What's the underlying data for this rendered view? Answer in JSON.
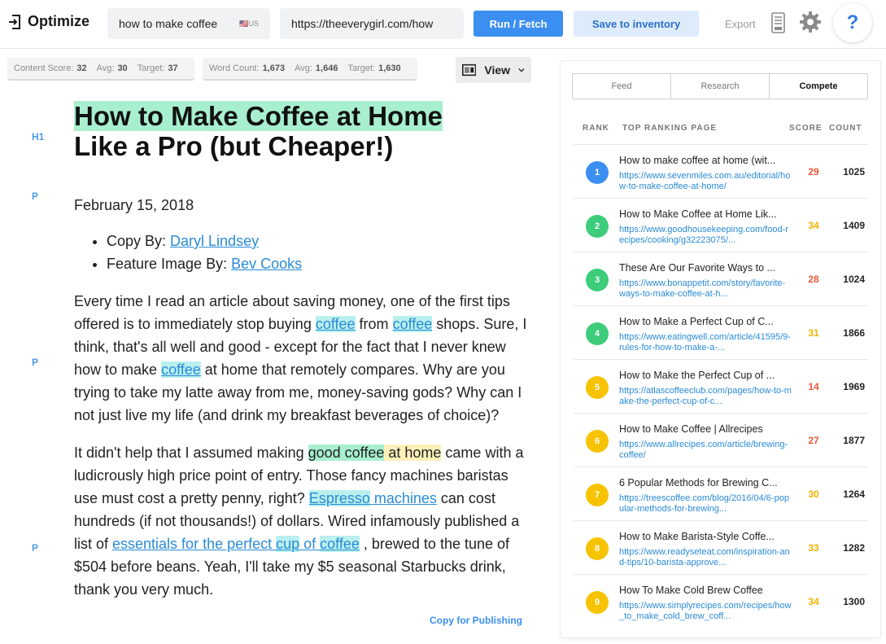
{
  "app": {
    "title": "Optimize"
  },
  "search": {
    "keyword": "how to make coffee",
    "locale": "US",
    "url": "https://theeverygirl.com/how"
  },
  "toolbar": {
    "run_label": "Run / Fetch",
    "save_label": "Save to inventory",
    "export_label": "Export",
    "help_label": "?"
  },
  "metrics": {
    "content_score": {
      "label": "Content Score:",
      "value": "32",
      "avg_label": "Avg:",
      "avg": "30",
      "target_label": "Target:",
      "target": "37"
    },
    "word_count": {
      "label": "Word Count:",
      "value": "1,673",
      "avg_label": "Avg:",
      "avg": "1,646",
      "target_label": "Target:",
      "target": "1,630"
    }
  },
  "view": {
    "label": "View"
  },
  "editor": {
    "tags": {
      "h1": "H1",
      "p": "P"
    },
    "h1_hl": "How to Make Coffee at Home",
    "h1_rest": "Like a Pro (but Cheaper!)",
    "date": "February 15, 2018",
    "credits": [
      {
        "label": "Copy By: ",
        "link": "Daryl Lindsey"
      },
      {
        "label": "Feature Image By: ",
        "link": "Bev Cooks"
      }
    ],
    "para1": {
      "t1": "Every time I read an article about saving money, one of the first tips offered is to immediately stop buying ",
      "k1": "coffee",
      "t2": " from ",
      "k2": "coffee",
      "t3": " shops. Sure, I think, that's all well and good - except for the fact that I never knew how to make ",
      "k3": "coffee",
      "t4": " at home that remotely compares. Why are you trying to take my latte away from me, money-saving gods? Why can I not just live my life (and drink my breakfast beverages of choice)?"
    },
    "para2": {
      "t1": "It didn't help that I assumed making ",
      "k1": "good coffee",
      "k2": " at home",
      "t2": " came with a ludicrously high price point of entry. Those fancy machines baristas use must cost a pretty penny, right? ",
      "k3": "Espresso",
      "l1": " machines",
      "t3": " can cost hundreds (if not thousands!) of dollars. Wired infamously published a list of ",
      "l2": "essentials for the perfect ",
      "k4": "cup",
      "l3": " of ",
      "k5": "coffee",
      "t4": " , brewed to the tune of $504 before beans. Yeah, I'll take my $5 seasonal Starbucks drink, thank you very much."
    },
    "copy_label": "Copy for Publishing"
  },
  "panel": {
    "tabs": [
      {
        "label": "Feed"
      },
      {
        "label": "Research"
      },
      {
        "label": "Compete"
      }
    ],
    "headers": {
      "rank": "RANK",
      "page": "TOP RANKING PAGE",
      "score": "SCORE",
      "count": "COUNT"
    },
    "results": [
      {
        "rank": "1",
        "title": "How to make coffee at home (wit...",
        "url": "https://www.sevenmiles.com.au/editorial/how-to-make-coffee-at-home/",
        "score": "29",
        "count": "1025",
        "rank_color": "#3b8ff0",
        "score_color": "#e8593b"
      },
      {
        "rank": "2",
        "title": "How to Make Coffee at Home Lik...",
        "url": "https://www.goodhousekeeping.com/food-recipes/cooking/g32223075/...",
        "score": "34",
        "count": "1409",
        "rank_color": "#3dcc7a",
        "score_color": "#f2b400"
      },
      {
        "rank": "3",
        "title": "These Are Our Favorite Ways to ...",
        "url": "https://www.bonappetit.com/story/favorite-ways-to-make-coffee-at-h...",
        "score": "28",
        "count": "1024",
        "rank_color": "#3dcc7a",
        "score_color": "#e8593b"
      },
      {
        "rank": "4",
        "title": "How to Make a Perfect Cup of C...",
        "url": "https://www.eatingwell.com/article/41595/9-rules-for-how-to-make-a-...",
        "score": "31",
        "count": "1866",
        "rank_color": "#3dcc7a",
        "score_color": "#f2b400"
      },
      {
        "rank": "5",
        "title": "How to Make the Perfect Cup of ...",
        "url": "https://atlascoffeeclub.com/pages/how-to-make-the-perfect-cup-of-c...",
        "score": "14",
        "count": "1969",
        "rank_color": "#f7c300",
        "score_color": "#e8593b"
      },
      {
        "rank": "6",
        "title": "How to Make Coffee | Allrecipes",
        "url": "https://www.allrecipes.com/article/brewing-coffee/",
        "score": "27",
        "count": "1877",
        "rank_color": "#f7c300",
        "score_color": "#e8593b"
      },
      {
        "rank": "7",
        "title": "6 Popular Methods for Brewing C...",
        "url": "https://treescoffee.com/blog/2016/04/6-popular-methods-for-brewing...",
        "score": "30",
        "count": "1264",
        "rank_color": "#f7c300",
        "score_color": "#f2b400"
      },
      {
        "rank": "8",
        "title": "How to Make Barista-Style Coffe...",
        "url": "https://www.readyseteat.com/inspiration-and-tips/10-barista-approve...",
        "score": "33",
        "count": "1282",
        "rank_color": "#f7c300",
        "score_color": "#f2b400"
      },
      {
        "rank": "9",
        "title": "How To Make Cold Brew Coffee",
        "url": "https://www.simplyrecipes.com/recipes/how_to_make_cold_brew_coff...",
        "score": "34",
        "count": "1300",
        "rank_color": "#f7c300",
        "score_color": "#f2b400"
      }
    ]
  }
}
